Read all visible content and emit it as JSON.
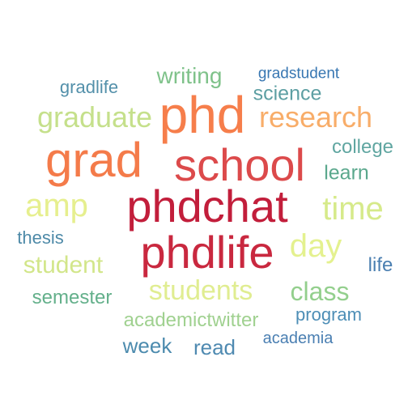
{
  "words": {
    "phd": {
      "text": "phd",
      "color": "#f67e4b"
    },
    "grad": {
      "text": "grad",
      "color": "#f47b4a"
    },
    "school": {
      "text": "school",
      "color": "#dc4a4b"
    },
    "phdchat": {
      "text": "phdchat",
      "color": "#c21e3b"
    },
    "phdlife": {
      "text": "phdlife",
      "color": "#c9283f"
    },
    "research": {
      "text": "research",
      "color": "#f8ad69"
    },
    "graduate": {
      "text": "graduate",
      "color": "#c5e08b"
    },
    "amp": {
      "text": "amp",
      "color": "#e6ef8e"
    },
    "time": {
      "text": "time",
      "color": "#d6ea8a"
    },
    "day": {
      "text": "day",
      "color": "#e4f18f"
    },
    "students": {
      "text": "students",
      "color": "#e0ed91"
    },
    "class": {
      "text": "class",
      "color": "#93cf8d"
    },
    "student": {
      "text": "student",
      "color": "#d2e68a"
    },
    "writing": {
      "text": "writing",
      "color": "#7fc28a"
    },
    "science": {
      "text": "science",
      "color": "#5d9fa3"
    },
    "learn": {
      "text": "learn",
      "color": "#5ba88d"
    },
    "college": {
      "text": "college",
      "color": "#60a6a1"
    },
    "semester": {
      "text": "semester",
      "color": "#64b08b"
    },
    "academictwitter": {
      "text": "academictwitter",
      "color": "#a0d190"
    },
    "read": {
      "text": "read",
      "color": "#4f8ab1"
    },
    "week": {
      "text": "week",
      "color": "#4c8bae"
    },
    "life": {
      "text": "life",
      "color": "#4a7eb0"
    },
    "thesis": {
      "text": "thesis",
      "color": "#4e8aa8"
    },
    "program": {
      "text": "program",
      "color": "#4d8eb6"
    },
    "gradlife": {
      "text": "gradlife",
      "color": "#5390aa"
    },
    "gradstudent": {
      "text": "gradstudent",
      "color": "#3877b2"
    },
    "academia": {
      "text": "academia",
      "color": "#4a7fb2"
    }
  }
}
